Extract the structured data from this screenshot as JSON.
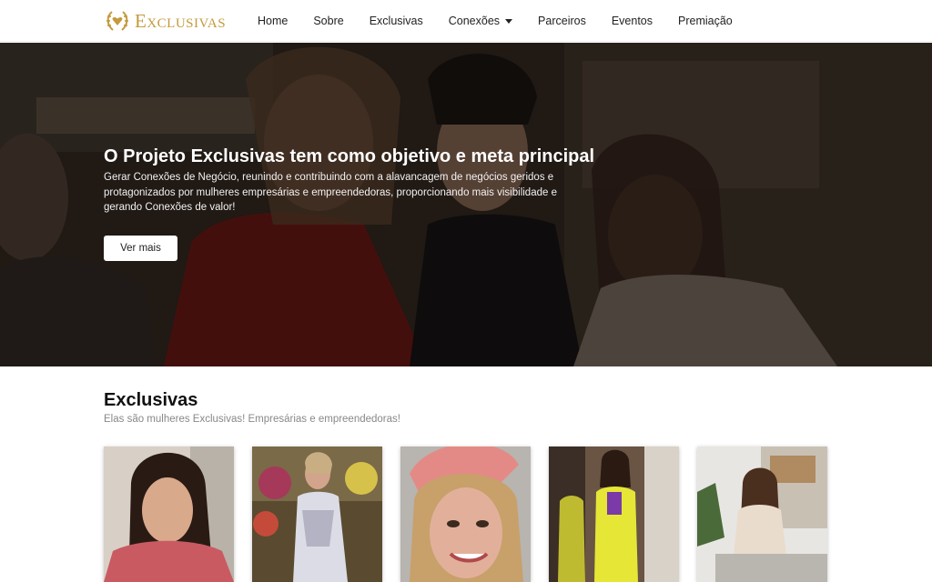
{
  "brand": {
    "name": "Exclusivas",
    "accent": "#c49a3c"
  },
  "nav": {
    "items": [
      {
        "label": "Home"
      },
      {
        "label": "Sobre"
      },
      {
        "label": "Exclusivas"
      },
      {
        "label": "Conexões",
        "dropdown": true
      },
      {
        "label": "Parceiros"
      },
      {
        "label": "Eventos"
      },
      {
        "label": "Premiação"
      }
    ]
  },
  "hero": {
    "title": "O Projeto Exclusivas tem como objetivo e meta principal",
    "description": "Gerar Conexões de Negócio, reunindo e contribuindo com a alavancagem de negócios geridos e protagonizados por mulheres empresárias e empreendedoras, proporcionando mais visibilidade e gerando Conexões de valor!",
    "button": "Ver mais"
  },
  "exclusivas": {
    "title": "Exclusivas",
    "subtitle": "Elas são mulheres Exclusivas! Empresárias e empreendedoras!"
  }
}
